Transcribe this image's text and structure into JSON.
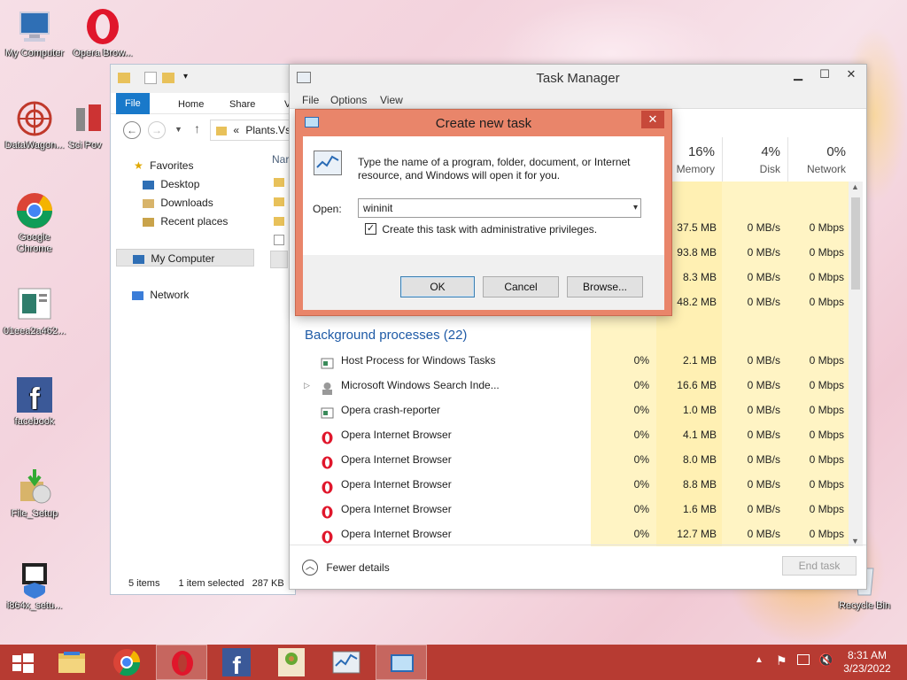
{
  "desktop": {
    "icons": [
      {
        "label": "My Computer"
      },
      {
        "label": "Opera Brow..."
      },
      {
        "label": "DataWagon..."
      },
      {
        "label": "Sci Pov"
      },
      {
        "label": "Google Chrome"
      },
      {
        "label": "01eea2a462..."
      },
      {
        "label": "facebook"
      },
      {
        "label": "File_Setup"
      },
      {
        "label": "i864x_setu..."
      },
      {
        "label": "Recycle Bin"
      }
    ]
  },
  "explorer": {
    "tabs": [
      "File",
      "Home",
      "Share",
      "Vi"
    ],
    "address": "Plants.Vs",
    "address_prefix": "«",
    "favorites": "Favorites",
    "desktop": "Desktop",
    "downloads": "Downloads",
    "recent": "Recent places",
    "my_computer": "My Computer",
    "network": "Network",
    "name_col": "Nar",
    "status_items": "5 items",
    "status_selected": "1 item selected",
    "status_size": "287 KB"
  },
  "task_manager": {
    "title": "Task Manager",
    "menu": [
      "File",
      "Options",
      "View"
    ],
    "columns": [
      {
        "pct": "16%",
        "name": "Memory"
      },
      {
        "pct": "4%",
        "name": "Disk"
      },
      {
        "pct": "0%",
        "name": "Network"
      }
    ],
    "app_rows": [
      {
        "memory": "37.5 MB",
        "disk": "0 MB/s",
        "network": "0 Mbps"
      },
      {
        "memory": "93.8 MB",
        "disk": "0 MB/s",
        "network": "0 Mbps"
      },
      {
        "memory": "8.3 MB",
        "disk": "0 MB/s",
        "network": "0 Mbps"
      },
      {
        "memory": "48.2 MB",
        "disk": "0 MB/s",
        "network": "0 Mbps"
      }
    ],
    "background_header": "Background processes (22)",
    "bg_rows": [
      {
        "name": "Host Process for Windows Tasks",
        "cpu": "0%",
        "memory": "2.1 MB",
        "disk": "0 MB/s",
        "network": "0 Mbps",
        "icon": "window-icon"
      },
      {
        "name": "Microsoft Windows Search Inde...",
        "cpu": "0%",
        "memory": "16.6 MB",
        "disk": "0 MB/s",
        "network": "0 Mbps",
        "icon": "search-user-icon"
      },
      {
        "name": "Opera crash-reporter",
        "cpu": "0%",
        "memory": "1.0 MB",
        "disk": "0 MB/s",
        "network": "0 Mbps",
        "icon": "window-icon"
      },
      {
        "name": "Opera Internet Browser",
        "cpu": "0%",
        "memory": "4.1 MB",
        "disk": "0 MB/s",
        "network": "0 Mbps",
        "icon": "opera-icon"
      },
      {
        "name": "Opera Internet Browser",
        "cpu": "0%",
        "memory": "8.0 MB",
        "disk": "0 MB/s",
        "network": "0 Mbps",
        "icon": "opera-icon"
      },
      {
        "name": "Opera Internet Browser",
        "cpu": "0%",
        "memory": "8.8 MB",
        "disk": "0 MB/s",
        "network": "0 Mbps",
        "icon": "opera-icon"
      },
      {
        "name": "Opera Internet Browser",
        "cpu": "0%",
        "memory": "1.6 MB",
        "disk": "0 MB/s",
        "network": "0 Mbps",
        "icon": "opera-icon"
      },
      {
        "name": "Opera Internet Browser",
        "cpu": "0%",
        "memory": "12.7 MB",
        "disk": "0 MB/s",
        "network": "0 Mbps",
        "icon": "opera-icon"
      }
    ],
    "fewer_details": "Fewer details",
    "end_task": "End task"
  },
  "dialog": {
    "title": "Create new task",
    "description": "Type the name of a program, folder, document, or Internet resource, and Windows will open it for you.",
    "open_label": "Open:",
    "open_value": "wininit",
    "admin_label": "Create this task with administrative privileges.",
    "admin_checked": true,
    "ok": "OK",
    "cancel": "Cancel",
    "browse": "Browse..."
  },
  "taskbar": {
    "time": "8:31 AM",
    "date": "3/23/2022",
    "accent": "#b73b32"
  }
}
